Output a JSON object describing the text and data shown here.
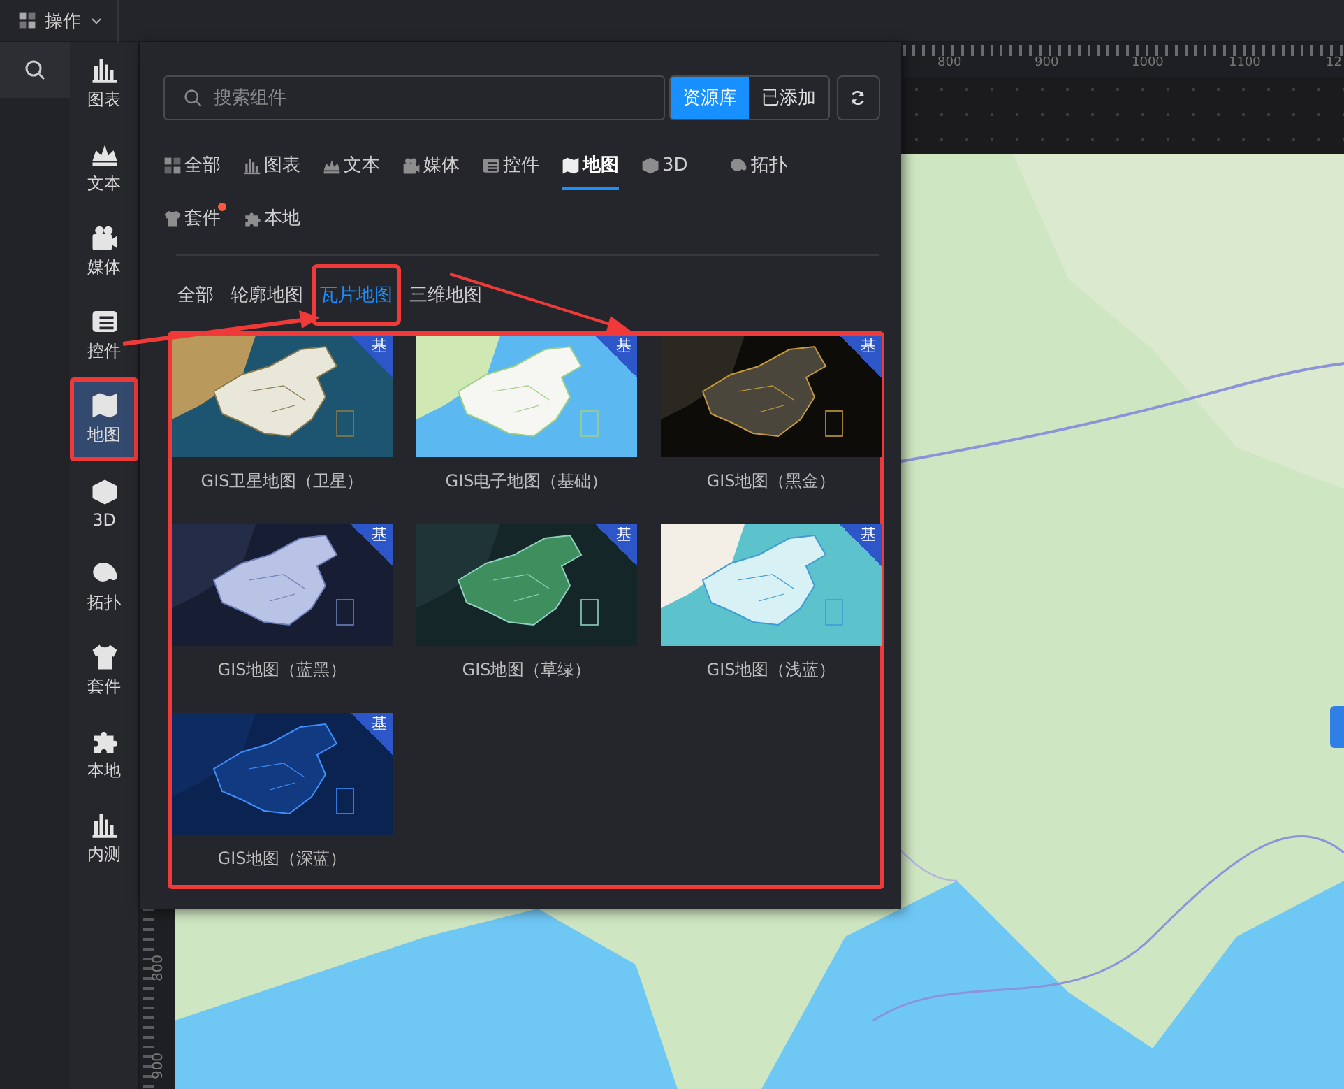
{
  "top_bar": {
    "menu_label": "操作"
  },
  "sidebar": {
    "items": [
      {
        "label": "图表",
        "selected": false,
        "highlighted": false
      },
      {
        "label": "文本",
        "selected": false,
        "highlighted": false
      },
      {
        "label": "媒体",
        "selected": false,
        "highlighted": false
      },
      {
        "label": "控件",
        "selected": false,
        "highlighted": false
      },
      {
        "label": "地图",
        "selected": true,
        "highlighted": true
      },
      {
        "label": "3D",
        "selected": false,
        "highlighted": false
      },
      {
        "label": "拓扑",
        "selected": false,
        "highlighted": false
      },
      {
        "label": "套件",
        "selected": false,
        "highlighted": false
      },
      {
        "label": "本地",
        "selected": false,
        "highlighted": false
      },
      {
        "label": "内测",
        "selected": false,
        "highlighted": false
      }
    ]
  },
  "panel": {
    "search": {
      "placeholder": "搜索组件"
    },
    "source_toggle": [
      {
        "label": "资源库",
        "selected": true
      },
      {
        "label": "已添加",
        "selected": false
      }
    ],
    "categories": [
      {
        "label": "全部",
        "selected": false,
        "dot": false
      },
      {
        "label": "图表",
        "selected": false,
        "dot": false
      },
      {
        "label": "文本",
        "selected": false,
        "dot": false
      },
      {
        "label": "媒体",
        "selected": false,
        "dot": false
      },
      {
        "label": "控件",
        "selected": false,
        "dot": false
      },
      {
        "label": "地图",
        "selected": true,
        "dot": false
      },
      {
        "label": "3D",
        "selected": false,
        "dot": false
      },
      {
        "label": "拓扑",
        "selected": false,
        "dot": false
      },
      {
        "label": "套件",
        "selected": false,
        "dot": true
      },
      {
        "label": "本地",
        "selected": false,
        "dot": false
      }
    ],
    "subtabs": [
      {
        "label": "全部",
        "selected": false,
        "highlighted": false
      },
      {
        "label": "轮廓地图",
        "selected": false,
        "highlighted": false
      },
      {
        "label": "瓦片地图",
        "selected": true,
        "highlighted": true
      },
      {
        "label": "三维地图",
        "selected": false,
        "highlighted": false
      }
    ],
    "cards": {
      "highlighted": true,
      "items": [
        {
          "title": "GIS卫星地图（卫星）",
          "badge": "基"
        },
        {
          "title": "GIS电子地图（基础）",
          "badge": "基"
        },
        {
          "title": "GIS地图（黑金）",
          "badge": "基"
        },
        {
          "title": "GIS地图（蓝黑）",
          "badge": "基"
        },
        {
          "title": "GIS地图（草绿）",
          "badge": "基"
        },
        {
          "title": "GIS地图（浅蓝）",
          "badge": "基"
        },
        {
          "title": "GIS地图（深蓝）",
          "badge": "基"
        }
      ]
    }
  },
  "top_ruler": {
    "labels": [
      "800",
      "900",
      "1000",
      "1100",
      "12"
    ]
  },
  "left_ruler": {
    "labels": [
      "800",
      "900"
    ]
  }
}
